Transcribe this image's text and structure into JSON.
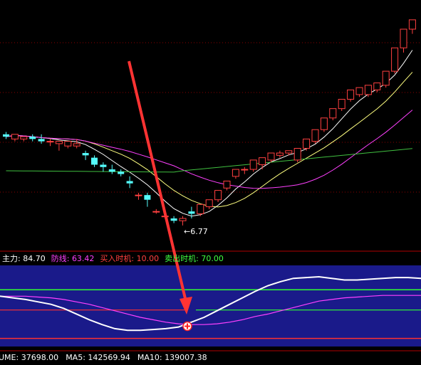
{
  "colors": {
    "background": "#000000",
    "up_candle": "#ff4040",
    "down_candle": "#54fcfc",
    "ma_white": "#ffffff",
    "ma_yellow": "#ffff80",
    "ma_magenta": "#ff40ff",
    "ma_green": "#40c040",
    "panel_fill": "#1a1a8a",
    "arrow": "#ff3333",
    "grid": "#8b0000"
  },
  "indicator_legend": {
    "main_label": "主力:",
    "main_value": "84.70",
    "defense_label": "防线:",
    "defense_value": "63.42",
    "buy_label": "买入时机:",
    "buy_value": "10.00",
    "sell_label": "卖出时机:",
    "sell_value": "70.00"
  },
  "volume_legend": {
    "vol_text": "UME: 37698.00",
    "ma5_text": "MA5: 142569.94",
    "ma10_text": "MA10: 139007.38"
  },
  "chart_data": [
    {
      "type": "candlestick",
      "annotations": [
        {
          "text": "6.77",
          "kind": "low-price"
        }
      ],
      "series": [
        {
          "name": "candles",
          "note": "price scale unlabeled; values in relative units",
          "ohlc": [
            [
              53,
              54,
              52,
              51
            ],
            [
              51,
              52,
              53,
              50
            ],
            [
              51,
              52,
              52,
              50
            ],
            [
              52,
              53,
              51,
              50
            ],
            [
              51,
              53,
              50,
              49
            ],
            [
              50,
              51,
              50,
              48
            ],
            [
              49,
              50,
              50,
              46
            ],
            [
              48,
              50,
              50,
              47
            ],
            [
              48,
              51,
              49,
              47
            ],
            [
              45,
              46,
              44,
              42
            ],
            [
              43,
              44,
              40,
              39
            ],
            [
              40,
              41,
              39,
              37
            ],
            [
              38,
              40,
              37,
              36
            ],
            [
              37,
              38,
              36,
              35
            ],
            [
              33,
              35,
              32,
              30
            ],
            [
              27,
              28,
              27,
              25
            ],
            [
              27,
              28,
              25,
              22
            ],
            [
              20,
              21,
              20,
              19
            ],
            [
              18,
              19,
              18,
              17
            ],
            [
              17,
              18,
              16,
              15
            ],
            [
              16,
              18,
              17,
              14
            ],
            [
              20,
              22,
              19,
              17
            ],
            [
              19,
              21,
              23,
              18
            ],
            [
              22,
              23,
              25,
              21
            ],
            [
              25,
              27,
              29,
              24
            ],
            [
              30,
              31,
              33,
              29
            ],
            [
              35,
              37,
              38,
              34
            ],
            [
              38,
              39,
              38,
              36
            ],
            [
              38,
              40,
              42,
              37
            ],
            [
              40,
              42,
              43,
              38
            ],
            [
              42,
              44,
              45,
              41
            ],
            [
              44,
              46,
              45,
              43
            ],
            [
              45,
              46,
              46,
              44
            ],
            [
              42,
              44,
              47,
              41
            ],
            [
              47,
              49,
              51,
              46
            ],
            [
              50,
              52,
              55,
              49
            ],
            [
              55,
              56,
              60,
              54
            ],
            [
              60,
              62,
              64,
              59
            ],
            [
              64,
              65,
              68,
              63
            ],
            [
              68,
              70,
              72,
              67
            ],
            [
              70,
              72,
              73,
              69
            ],
            [
              70,
              72,
              74,
              69
            ],
            [
              72,
              74,
              75,
              71
            ],
            [
              74,
              76,
              80,
              73
            ],
            [
              80,
              82,
              90,
              79
            ],
            [
              90,
              92,
              98,
              88
            ],
            [
              98,
              100,
              102,
              96
            ]
          ]
        },
        {
          "name": "MA-white"
        },
        {
          "name": "MA-yellow"
        },
        {
          "name": "MA-magenta"
        },
        {
          "name": "MA-green"
        }
      ]
    },
    {
      "type": "line",
      "ylim": [
        0,
        100
      ],
      "series": [
        {
          "name": "主力",
          "values": [
            62,
            60,
            58,
            55,
            52,
            47,
            40,
            33,
            27,
            22,
            20,
            20,
            21,
            22,
            24,
            30,
            36,
            44,
            52,
            60,
            68,
            75,
            80,
            84,
            85,
            86,
            84,
            82,
            82,
            83,
            84,
            85,
            85,
            84
          ]
        },
        {
          "name": "防线",
          "values": [
            62,
            62,
            62,
            61,
            60,
            58,
            55,
            52,
            48,
            44,
            40,
            36,
            33,
            30,
            28,
            27,
            27,
            28,
            30,
            33,
            37,
            40,
            44,
            48,
            52,
            56,
            58,
            60,
            61,
            62,
            63,
            63,
            63,
            63
          ]
        },
        {
          "name": "买入时机",
          "values": [
            10
          ]
        },
        {
          "name": "卖出时机",
          "values": [
            70
          ]
        }
      ]
    }
  ]
}
